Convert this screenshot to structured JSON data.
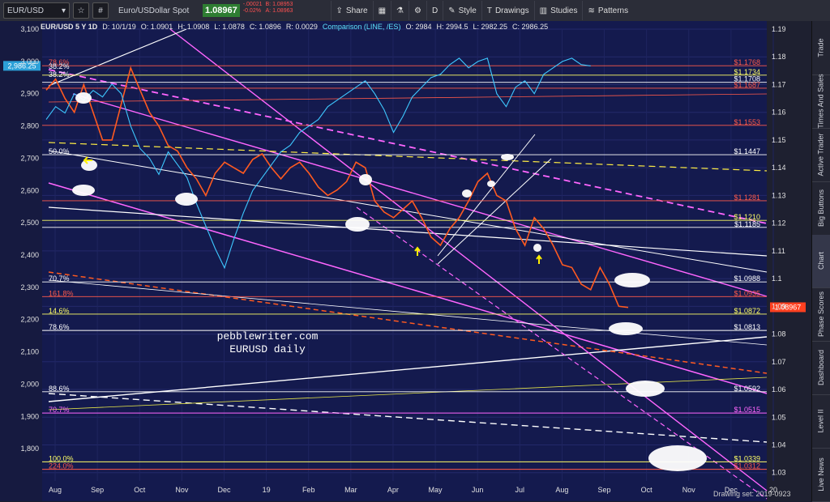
{
  "toolbar": {
    "symbol": "EUR/USD",
    "name": "Euro/USDollar Spot",
    "last": "1.08967",
    "change": "-.00021",
    "change_pct": "-0.02%",
    "bid": "B: 1.08953",
    "ask": "A: 1.08963",
    "share": "Share",
    "period": "D",
    "style": "Style",
    "drawings": "Drawings",
    "studies": "Studies",
    "patterns": "Patterns"
  },
  "infobar": {
    "title": "EUR/USD 5 Y 1D",
    "d": "D: 10/1/19",
    "o": "O: 1.0901",
    "h": "H: 1.0908",
    "l": "L: 1.0878",
    "c": "C: 1.0896",
    "r": "R: 0.0029",
    "comparison": "Comparison (LINE, /ES)",
    "co": "O: 2984",
    "ch": "H: 2994.5",
    "cl": "L: 2982.25",
    "cc": "C: 2986.25"
  },
  "watermark": [
    "pebblewriter.com",
    "EURUSD daily"
  ],
  "left_current": "2,986.25",
  "right_current": "1.08967",
  "fib_left": [
    {
      "label": "78.6%",
      "y": 1.1768,
      "color": "#ff5a4a"
    },
    {
      "label": "38.2%",
      "y": 1.1754,
      "color": "#ffffff"
    },
    {
      "label": "38.2%",
      "y": 1.1725,
      "color": "#ffffff"
    },
    {
      "label": "50.0%",
      "y": 1.1447,
      "color": "#ffffff"
    },
    {
      "label": "70.7%",
      "y": 1.0988,
      "color": "#ffffff"
    },
    {
      "label": "161.8%",
      "y": 1.0935,
      "color": "#ff5a4a"
    },
    {
      "label": "14.6%",
      "y": 1.0872,
      "color": "#ffff66"
    },
    {
      "label": "78.6%",
      "y": 1.0813,
      "color": "#ffffff"
    },
    {
      "label": "88.6%",
      "y": 1.0592,
      "color": "#ffffff"
    },
    {
      "label": "70.7%",
      "y": 1.0515,
      "color": "#ff66ff"
    },
    {
      "label": "100.0%",
      "y": 1.0339,
      "color": "#ffff66"
    },
    {
      "label": "224.0%",
      "y": 1.0312,
      "color": "#ff5a4a"
    }
  ],
  "price_tags": [
    {
      "label": "$1.1768",
      "y": 1.1768,
      "color": "#ff5a4a"
    },
    {
      "label": "$1.1734",
      "y": 1.1734,
      "color": "#ffff66"
    },
    {
      "label": "$1.1708",
      "y": 1.1708,
      "color": "#ffffff"
    },
    {
      "label": "$1.1687",
      "y": 1.1687,
      "color": "#ff5a4a"
    },
    {
      "label": "$1.1553",
      "y": 1.1553,
      "color": "#ff5a4a"
    },
    {
      "label": "$1.1447",
      "y": 1.1447,
      "color": "#ffffff"
    },
    {
      "label": "$1.1281",
      "y": 1.1281,
      "color": "#ff5a4a"
    },
    {
      "label": "$1.1210",
      "y": 1.121,
      "color": "#ffff66"
    },
    {
      "label": "$1.1185",
      "y": 1.1185,
      "color": "#ffffff"
    },
    {
      "label": "$1.0988",
      "y": 1.0988,
      "color": "#ffffff"
    },
    {
      "label": "$1.0935",
      "y": 1.0935,
      "color": "#ff5a4a"
    },
    {
      "label": "$1.0872",
      "y": 1.0872,
      "color": "#ffff66"
    },
    {
      "label": "$1.0813",
      "y": 1.0813,
      "color": "#ffffff"
    },
    {
      "label": "$1.0592",
      "y": 1.0592,
      "color": "#ffffff"
    },
    {
      "label": "$1.0515",
      "y": 1.0515,
      "color": "#ff66ff"
    },
    {
      "label": "$1.0339",
      "y": 1.0339,
      "color": "#ffff66"
    },
    {
      "label": "$1.0312",
      "y": 1.0312,
      "color": "#ff5a4a"
    }
  ],
  "side_tabs": [
    "Trade",
    "Times And Sales",
    "Active Trader",
    "Big Buttons",
    "Chart",
    "Phase Scores",
    "Dashboard",
    "Level II",
    "Live News"
  ],
  "drawing_set": "Drawing set: 2019-0923",
  "chart_data": {
    "type": "line",
    "title": "EUR/USD 5 Y 1D",
    "x_ticks": [
      "Aug",
      "Sep",
      "Oct",
      "Nov",
      "Dec",
      "19",
      "Feb",
      "Mar",
      "Apr",
      "May",
      "Jun",
      "Jul",
      "Aug",
      "Sep",
      "Oct",
      "Nov",
      "Dec",
      "20"
    ],
    "right_axis": {
      "ticks": [
        1.19,
        1.18,
        1.17,
        1.16,
        1.15,
        1.14,
        1.13,
        1.12,
        1.11,
        1.1,
        1.09,
        1.08,
        1.07,
        1.06,
        1.05,
        1.04,
        1.03
      ],
      "range": [
        1.027,
        1.19
      ]
    },
    "left_axis": {
      "ticks": [
        "3,100",
        "3,000",
        "2,900",
        "2,800",
        "2,700",
        "2,600",
        "2,500",
        "2,400",
        "2,300",
        "2,200",
        "2,100",
        "2,000",
        "1,900",
        "1,800"
      ],
      "range": [
        1700,
        3100
      ]
    },
    "series": [
      {
        "name": "EUR/USD",
        "axis": "right",
        "color": "#ff5a20",
        "points": [
          [
            0,
            1.168
          ],
          [
            5,
            1.172
          ],
          [
            10,
            1.165
          ],
          [
            15,
            1.16
          ],
          [
            20,
            1.17
          ],
          [
            25,
            1.16
          ],
          [
            30,
            1.15
          ],
          [
            35,
            1.15
          ],
          [
            40,
            1.163
          ],
          [
            45,
            1.176
          ],
          [
            50,
            1.168
          ],
          [
            55,
            1.16
          ],
          [
            60,
            1.155
          ],
          [
            65,
            1.148
          ],
          [
            70,
            1.146
          ],
          [
            75,
            1.14
          ],
          [
            80,
            1.136
          ],
          [
            85,
            1.13
          ],
          [
            90,
            1.138
          ],
          [
            95,
            1.142
          ],
          [
            100,
            1.14
          ],
          [
            105,
            1.138
          ],
          [
            110,
            1.143
          ],
          [
            115,
            1.145
          ],
          [
            120,
            1.14
          ],
          [
            125,
            1.136
          ],
          [
            130,
            1.14
          ],
          [
            135,
            1.142
          ],
          [
            140,
            1.138
          ],
          [
            145,
            1.133
          ],
          [
            150,
            1.13
          ],
          [
            155,
            1.132
          ],
          [
            160,
            1.135
          ],
          [
            165,
            1.142
          ],
          [
            170,
            1.14
          ],
          [
            175,
            1.128
          ],
          [
            180,
            1.124
          ],
          [
            185,
            1.122
          ],
          [
            190,
            1.125
          ],
          [
            195,
            1.128
          ],
          [
            200,
            1.122
          ],
          [
            205,
            1.115
          ],
          [
            210,
            1.112
          ],
          [
            215,
            1.118
          ],
          [
            220,
            1.122
          ],
          [
            225,
            1.128
          ],
          [
            230,
            1.135
          ],
          [
            235,
            1.138
          ],
          [
            240,
            1.13
          ],
          [
            245,
            1.128
          ],
          [
            250,
            1.118
          ],
          [
            255,
            1.112
          ],
          [
            260,
            1.122
          ],
          [
            265,
            1.118
          ],
          [
            270,
            1.112
          ],
          [
            275,
            1.105
          ],
          [
            280,
            1.104
          ],
          [
            285,
            1.098
          ],
          [
            290,
            1.096
          ],
          [
            295,
            1.104
          ],
          [
            300,
            1.098
          ],
          [
            305,
            1.09
          ],
          [
            310,
            1.0896
          ]
        ]
      },
      {
        "name": "/ES",
        "axis": "left",
        "color": "#3ec8ff",
        "points": [
          [
            0,
            2820
          ],
          [
            5,
            2860
          ],
          [
            10,
            2840
          ],
          [
            15,
            2900
          ],
          [
            20,
            2880
          ],
          [
            25,
            2910
          ],
          [
            30,
            2890
          ],
          [
            35,
            2930
          ],
          [
            40,
            2900
          ],
          [
            45,
            2800
          ],
          [
            50,
            2730
          ],
          [
            55,
            2700
          ],
          [
            60,
            2650
          ],
          [
            65,
            2720
          ],
          [
            70,
            2680
          ],
          [
            75,
            2640
          ],
          [
            80,
            2560
          ],
          [
            85,
            2490
          ],
          [
            90,
            2420
          ],
          [
            95,
            2360
          ],
          [
            100,
            2450
          ],
          [
            105,
            2530
          ],
          [
            110,
            2600
          ],
          [
            115,
            2640
          ],
          [
            120,
            2680
          ],
          [
            125,
            2720
          ],
          [
            130,
            2740
          ],
          [
            135,
            2780
          ],
          [
            140,
            2800
          ],
          [
            145,
            2820
          ],
          [
            150,
            2860
          ],
          [
            155,
            2880
          ],
          [
            160,
            2900
          ],
          [
            165,
            2920
          ],
          [
            170,
            2940
          ],
          [
            175,
            2900
          ],
          [
            180,
            2850
          ],
          [
            185,
            2780
          ],
          [
            190,
            2830
          ],
          [
            195,
            2890
          ],
          [
            200,
            2920
          ],
          [
            205,
            2950
          ],
          [
            210,
            2960
          ],
          [
            215,
            2990
          ],
          [
            220,
            3010
          ],
          [
            225,
            2980
          ],
          [
            230,
            3000
          ],
          [
            235,
            3010
          ],
          [
            240,
            2900
          ],
          [
            245,
            2860
          ],
          [
            250,
            2920
          ],
          [
            255,
            2940
          ],
          [
            260,
            2900
          ],
          [
            265,
            2960
          ],
          [
            270,
            2980
          ],
          [
            275,
            3000
          ],
          [
            280,
            3010
          ],
          [
            285,
            2990
          ],
          [
            290,
            2986
          ]
        ]
      }
    ]
  }
}
